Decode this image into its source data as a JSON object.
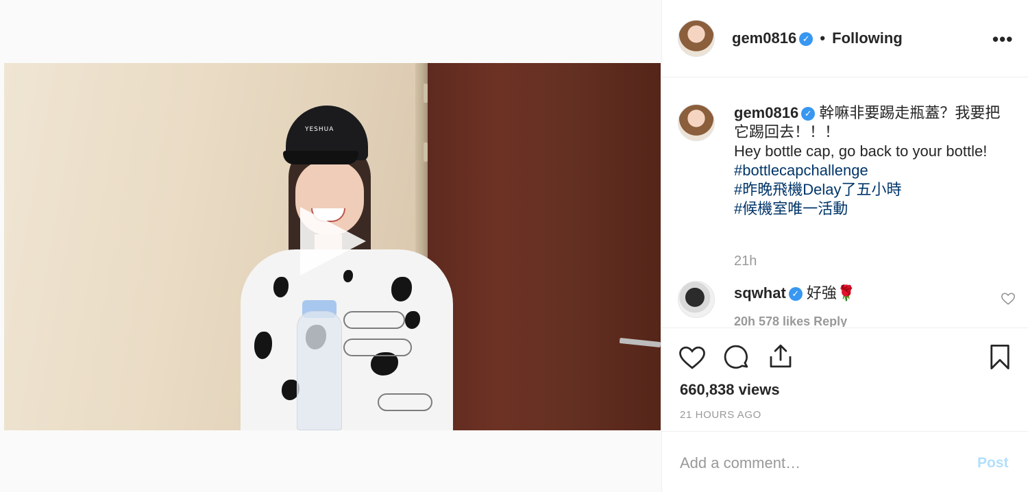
{
  "header": {
    "username": "gem0816",
    "verified_glyph": "✓",
    "separator": "•",
    "follow_status": "Following",
    "more_glyph": "•••"
  },
  "media": {
    "cap_print": "YESHUA",
    "play_icon": "play-icon"
  },
  "caption": {
    "username": "gem0816",
    "text_zh": "幹嘛非要踢走瓶蓋？我要把它踢回去！！！",
    "text_en": "Hey bottle cap, go back to your bottle!",
    "hashtags": [
      "#bottlecapchallenge",
      "#昨晚飛機Delay了五小時",
      "#候機室唯一活動"
    ],
    "age": "21h"
  },
  "comments": [
    {
      "username": "sqwhat",
      "text": "好強",
      "emoji": "🌹",
      "meta": "20h   578 likes   Reply"
    }
  ],
  "actions": {
    "views": "660,838 views",
    "posted": "21 HOURS AGO"
  },
  "add_comment": {
    "placeholder": "Add a comment…",
    "post_label": "Post"
  },
  "colors": {
    "link": "#003569",
    "verified": "#3897f0",
    "muted": "#999999",
    "post_disabled": "#b2dffc"
  }
}
